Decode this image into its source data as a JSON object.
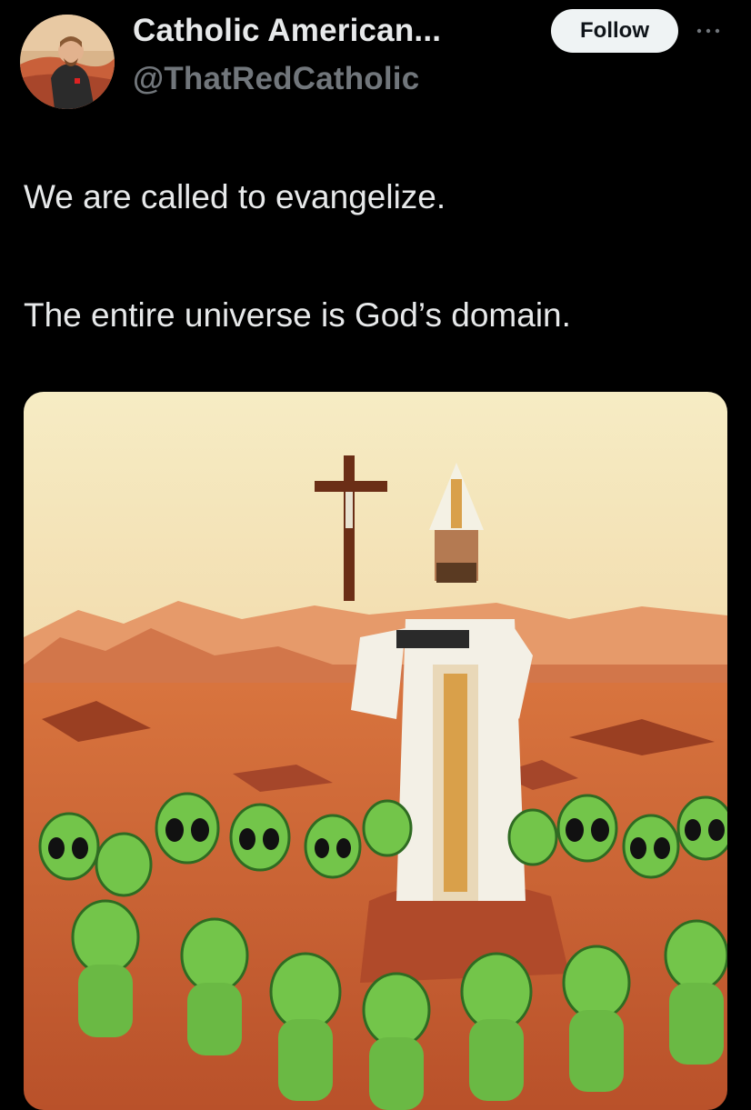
{
  "author": {
    "display_name": "Catholic American...",
    "handle": "@ThatRedCatholic",
    "avatar_icon": "profile-photo"
  },
  "actions": {
    "follow_label": "Follow",
    "more_icon": "ellipsis-icon"
  },
  "tweet": {
    "paragraphs": [
      "We are called to evangelize.",
      "The entire universe is God’s domain."
    ]
  },
  "media": {
    "type": "image",
    "description_icon": "pixel-art-image"
  },
  "colors": {
    "background": "#000000",
    "text": "#e7e9ea",
    "secondary_text": "#71767b",
    "follow_bg": "#eff3f4",
    "follow_text": "#0f1419"
  }
}
